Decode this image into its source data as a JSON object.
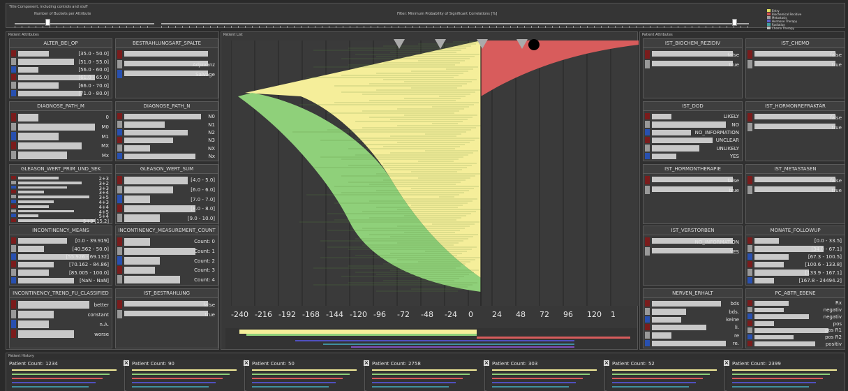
{
  "top": {
    "title": "Title Component, including controls and stuff",
    "buckets_label": "Number of Buckets per Attribute",
    "filter_label": "Filter: Minimum Probability of Significant Correlations [%]",
    "legend": [
      {
        "label": "Entry",
        "color": "#e0e060"
      },
      {
        "label": "Biochemical Recidive",
        "color": "#d05050"
      },
      {
        "label": "Metastasis",
        "color": "#a0a0a0"
      },
      {
        "label": "Hormone Therapy",
        "color": "#6060d0"
      },
      {
        "label": "Radiation",
        "color": "#40a0a0"
      },
      {
        "label": "Chemo Therapy",
        "color": "#c0c0c0"
      }
    ]
  },
  "left_panel": {
    "title": "Patient Attributes",
    "cards": [
      {
        "title": "ALTER_BEI_OP",
        "labels": [
          "[35.0 - 50.0]",
          "[51.0 - 55.0]",
          "[56.0 - 60.0]",
          "[61.0 - 65.0]",
          "[66.0 - 70.0]",
          "[71.0 - 80.0]"
        ]
      },
      {
        "title": "BESTRAHLUNGSART_SPALTE",
        "labels": [
          "",
          "Adjuvanz",
          "Salvage"
        ]
      },
      {
        "title": "DIAGNOSE_PATH_M",
        "labels": [
          "0",
          "M0",
          "M1",
          "MX",
          "Mx"
        ]
      },
      {
        "title": "DIAGNOSE_PATH_N",
        "labels": [
          "N0",
          "N1",
          "N2",
          "N3",
          "NX",
          "Nx"
        ]
      },
      {
        "title": "GLEASON_WERT_PRIM_UND_SEK",
        "labels": [
          "2+3",
          "3+2",
          "3+3",
          "3+4",
          "3+5",
          "4+3",
          "4+4",
          "4+5",
          "5+4",
          "5+3 [15.2]"
        ]
      },
      {
        "title": "GLEASON_WERT_SUM",
        "labels": [
          "[4.0 - 5.0]",
          "[6.0 - 6.0]",
          "[7.0 - 7.0]",
          "[8.0 - 8.0]",
          "[9.0 - 10.0]"
        ]
      },
      {
        "title": "INCONTINENCY_MEANS",
        "labels": [
          "[0.0 - 39.919]",
          "[40.562 - 50.0]",
          "[55.926 - 69.132]",
          "[70.162 - 84.86]",
          "[85.005 - 100.0]",
          "[NaN - NaN]"
        ]
      },
      {
        "title": "INCONTINENCY_MEASUREMENT_COUNT",
        "labels": [
          "Count: 0",
          "Count: 1",
          "Count: 2",
          "Count: 3",
          "Count: 4"
        ]
      },
      {
        "title": "INCONTINENCY_TREND_FU_CLASSIFIED",
        "labels": [
          "better",
          "constant",
          "n.A.",
          "worse"
        ]
      },
      {
        "title": "IST_BESTRAHLUNG",
        "labels": [
          "false",
          "true"
        ]
      }
    ]
  },
  "main": {
    "title": "Patient List",
    "axis_labels": [
      "-240",
      "-216",
      "-192",
      "-168",
      "-144",
      "-120",
      "-96",
      "-72",
      "-48",
      "-24",
      "0",
      "24",
      "48",
      "72",
      "96",
      "120",
      "1"
    ]
  },
  "right_panel": {
    "title": "Patient Attributes",
    "cards": [
      {
        "title": "IST_BIOCHEM_REZIDIV",
        "labels": [
          "false",
          "true"
        ]
      },
      {
        "title": "IST_CHEMO",
        "labels": [
          "false",
          "true"
        ]
      },
      {
        "title": "IST_DOD",
        "labels": [
          "LIKELY",
          "NO",
          "NO_INFORMATION",
          "UNCLEAR",
          "UNLIKELY",
          "YES"
        ]
      },
      {
        "title": "IST_HORMONREFRAKTÄR",
        "labels": [
          "false",
          "true"
        ]
      },
      {
        "title": "IST_HORMONTHERAPIE",
        "labels": [
          "false",
          "true"
        ]
      },
      {
        "title": "IST_METASTASEN",
        "labels": [
          "false",
          "true"
        ]
      },
      {
        "title": "IST_VERSTORBEN",
        "labels": [
          "NO_INFORMATION",
          "YES"
        ]
      },
      {
        "title": "MONATE_FOLLOWUP",
        "labels": [
          "[0.0 - 33.5]",
          "[34.0 - 67.1]",
          "[67.3 - 100.5]",
          "[100.6 - 133.8]",
          "[133.9 - 167.1]",
          "[167.8 - 24494.2]"
        ]
      },
      {
        "title": "NERVEN_ERHALT",
        "labels": [
          "bds",
          "bds.",
          "keine",
          "li.",
          "re",
          "re."
        ]
      },
      {
        "title": "PC_ABTR_EBENE",
        "labels": [
          "Rx",
          "negativ",
          "negativ",
          "pos",
          "pos R1",
          "pos R2",
          "positiv"
        ]
      }
    ]
  },
  "history": {
    "title": "Patient History",
    "items": [
      "Patient Count: 1234",
      "Patient Count: 90",
      "Patient Count: 50",
      "Patient Count: 2758",
      "Patient Count: 303",
      "Patient Count: 52",
      "Patient Count: 2399"
    ]
  },
  "colors": {
    "green": "#8fd07a",
    "yellow": "#f5ee9a",
    "red": "#d85c5c",
    "blue": "#2850b0",
    "darkred": "#7a1c1c"
  }
}
